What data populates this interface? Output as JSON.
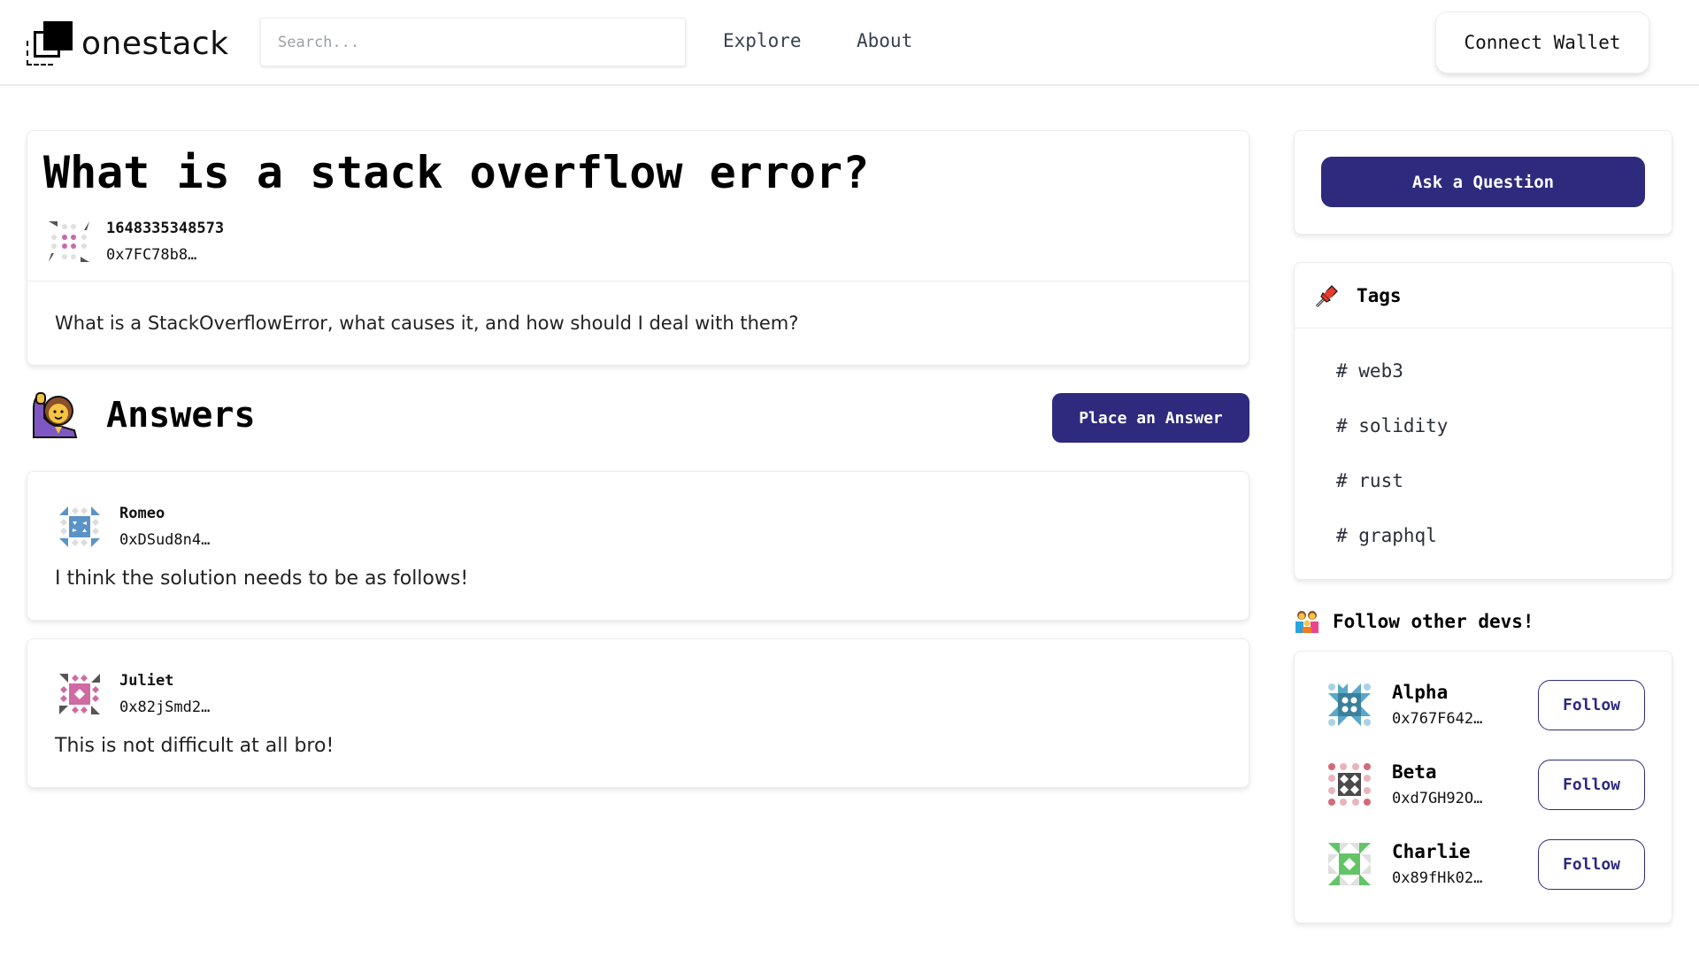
{
  "header": {
    "brand": "onestack",
    "search_placeholder": "Search...",
    "search_value": "",
    "nav": [
      {
        "label": "Explore"
      },
      {
        "label": "About"
      }
    ],
    "connect_wallet_label": "Connect Wallet"
  },
  "question": {
    "title": "What is a stack overflow error?",
    "timestamp": "1648335348573",
    "author_address": "0x7FC78b8…",
    "body": "What is a StackOverflowError, what causes it, and how should I deal with them?",
    "avatar_icon": "identicon-pink-gray"
  },
  "answers_section": {
    "icon": "person-raising-hand-icon",
    "title": "Answers",
    "place_answer_label": "Place an Answer",
    "items": [
      {
        "name": "Romeo",
        "address": "0xDSud8n4…",
        "body": "I think the solution needs to be as follows!",
        "avatar_icon": "identicon-blue"
      },
      {
        "name": "Juliet",
        "address": "0x82jSmd2…",
        "body": "This is not difficult at all bro!",
        "avatar_icon": "identicon-pink"
      }
    ]
  },
  "sidebar": {
    "ask_question_label": "Ask a Question",
    "tags": {
      "icon": "pushpin-icon",
      "title": "Tags",
      "items": [
        {
          "label": "# web3"
        },
        {
          "label": "# solidity"
        },
        {
          "label": "# rust"
        },
        {
          "label": "# graphql"
        }
      ]
    },
    "follow": {
      "icon": "family-icon",
      "title": "Follow other devs!",
      "follow_label": "Follow",
      "devs": [
        {
          "name": "Alpha",
          "address": "0x767F642…",
          "avatar_icon": "identicon-teal"
        },
        {
          "name": "Beta",
          "address": "0xd7GH92O…",
          "avatar_icon": "identicon-red-dark"
        },
        {
          "name": "Charlie",
          "address": "0x89fHk02…",
          "avatar_icon": "identicon-green"
        }
      ]
    }
  },
  "colors": {
    "accent": "#2e2a7e",
    "text": "#111111",
    "border": "#ececec"
  }
}
